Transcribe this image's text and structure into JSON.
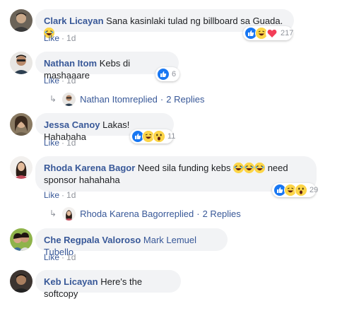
{
  "comments": [
    {
      "name": "Clark Licayan",
      "text": " Sana kasinlaki tulad ng billboard sa Guada. ",
      "like": "Like",
      "time": "1d",
      "reaction_count": "217"
    },
    {
      "name": "Nathan Itom",
      "text": " Kebs di mashaaare",
      "like": "Like",
      "time": "1d",
      "reaction_count": "6",
      "replies": {
        "name": "Nathan Itom",
        "replied": " replied",
        "count": "2 Replies"
      }
    },
    {
      "name": "Jessa Canoy",
      "text": " Lakas! Hahahaha",
      "like": "Like",
      "time": "1d",
      "reaction_count": "11"
    },
    {
      "name": "Rhoda Karena Bagor",
      "text_a": " Need sila funding kebs ",
      "text_b": " need",
      "text_c": "sponsor hahahaha",
      "like": "Like",
      "time": "1d",
      "reaction_count": "29",
      "replies": {
        "name": "Rhoda Karena Bagor",
        "replied": " replied",
        "count": "2 Replies"
      }
    },
    {
      "name": "Che Regpala Valoroso",
      "tag": "Mark Lemuel Tubello",
      "like": "Like",
      "time": "1d"
    },
    {
      "name": "Keb Licayan",
      "text": " Here's the softcopy"
    }
  ],
  "colors": {
    "name": "#385898",
    "bubble": "#f2f3f5",
    "meta": "#90949c",
    "like_reaction": "#1877f2",
    "haha": "#fcd548",
    "love": "#f33e58"
  },
  "icons": [
    "like-reaction-icon",
    "haha-reaction-icon",
    "love-reaction-icon",
    "wow-reaction-icon",
    "reply-arrow-icon"
  ]
}
